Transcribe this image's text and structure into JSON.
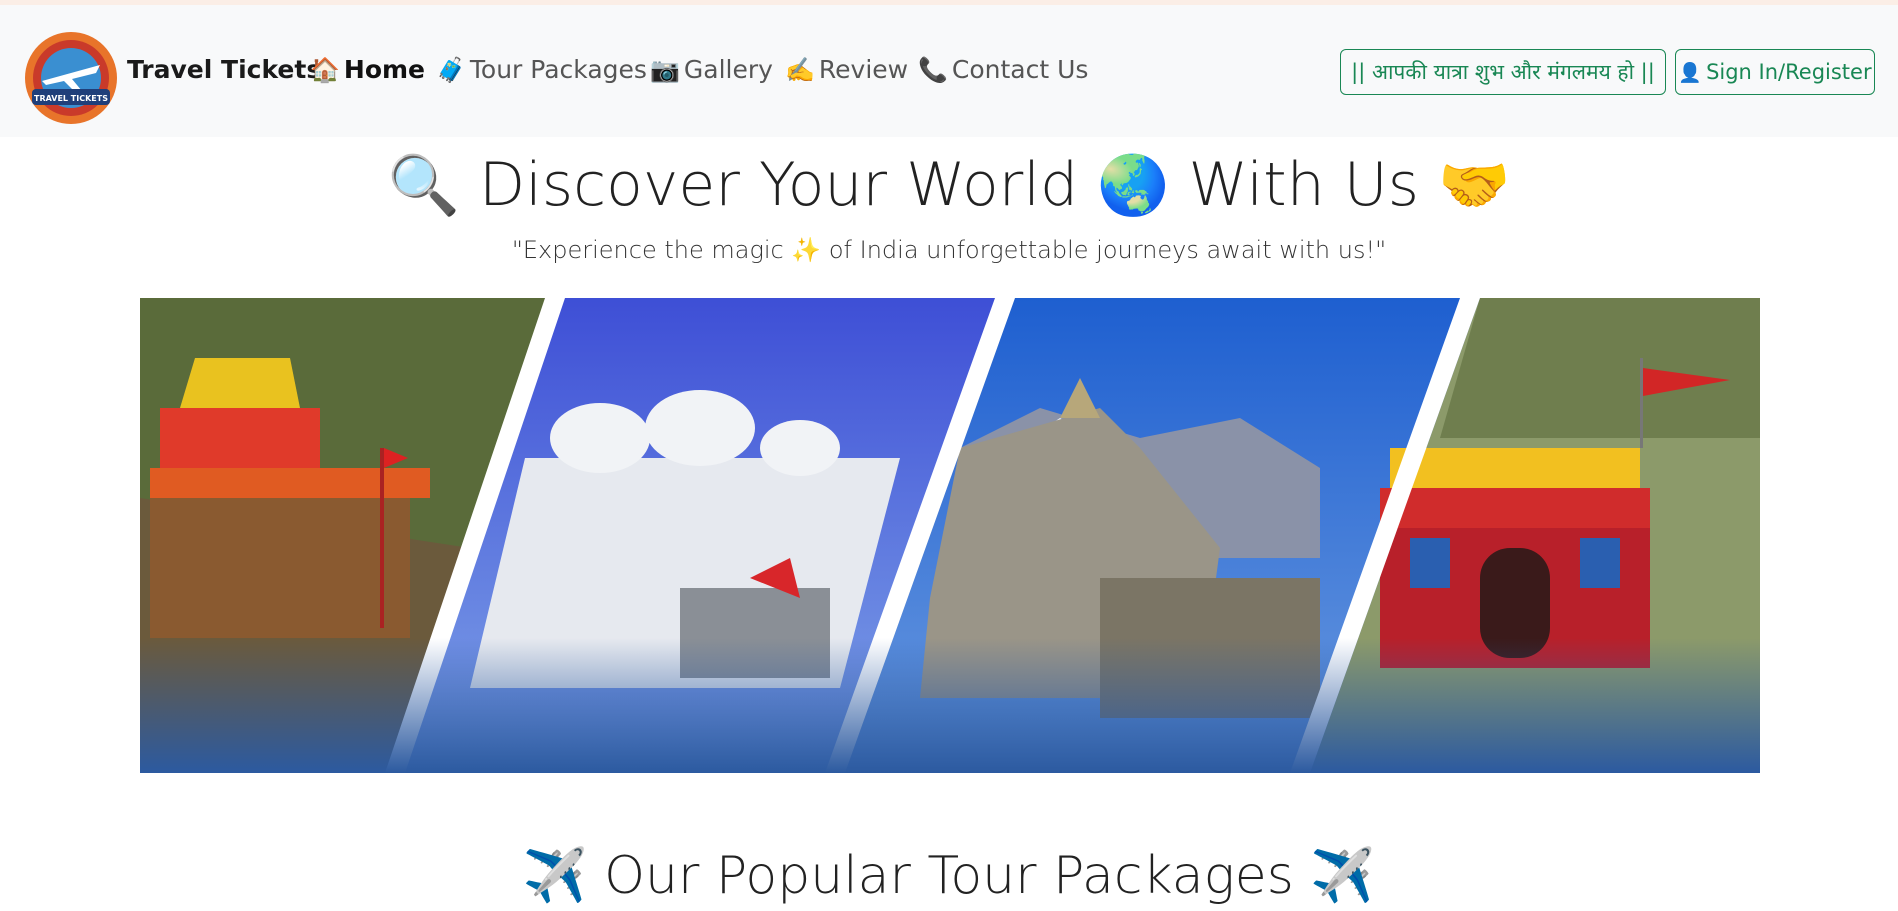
{
  "navbar": {
    "brand": "Travel Tickets",
    "logo_text": "TRAVEL TICKETS",
    "items": [
      {
        "icon": "🏠",
        "label": "Home",
        "active": true
      },
      {
        "icon": "🧳",
        "label": "Tour Packages",
        "active": false
      },
      {
        "icon": "📷",
        "label": "Gallery",
        "active": false
      },
      {
        "icon": "✍️",
        "label": "Review",
        "active": false
      },
      {
        "icon": "📞",
        "label": "Contact Us",
        "active": false
      }
    ],
    "blessing_button": "|| आपकी यात्रा शुभ और मंगलमय हो ||",
    "signin_icon": "👤",
    "signin_button": "Sign In/Register"
  },
  "hero": {
    "title_part1": "Discover Your World",
    "title_part2": "With Us",
    "icons": [
      "🔍",
      "🌏",
      "🤝"
    ],
    "subtitle_part1": "\"Experience the magic",
    "subtitle_icon": "✨",
    "subtitle_part2": "of India unforgettable journeys await with us!\""
  },
  "section": {
    "title": "Our Popular Tour Packages",
    "icon": "✈️"
  },
  "colors": {
    "accent_green": "#198754",
    "navbar_bg": "#f8f9fa",
    "banner_blue": "#2c5aa0"
  }
}
